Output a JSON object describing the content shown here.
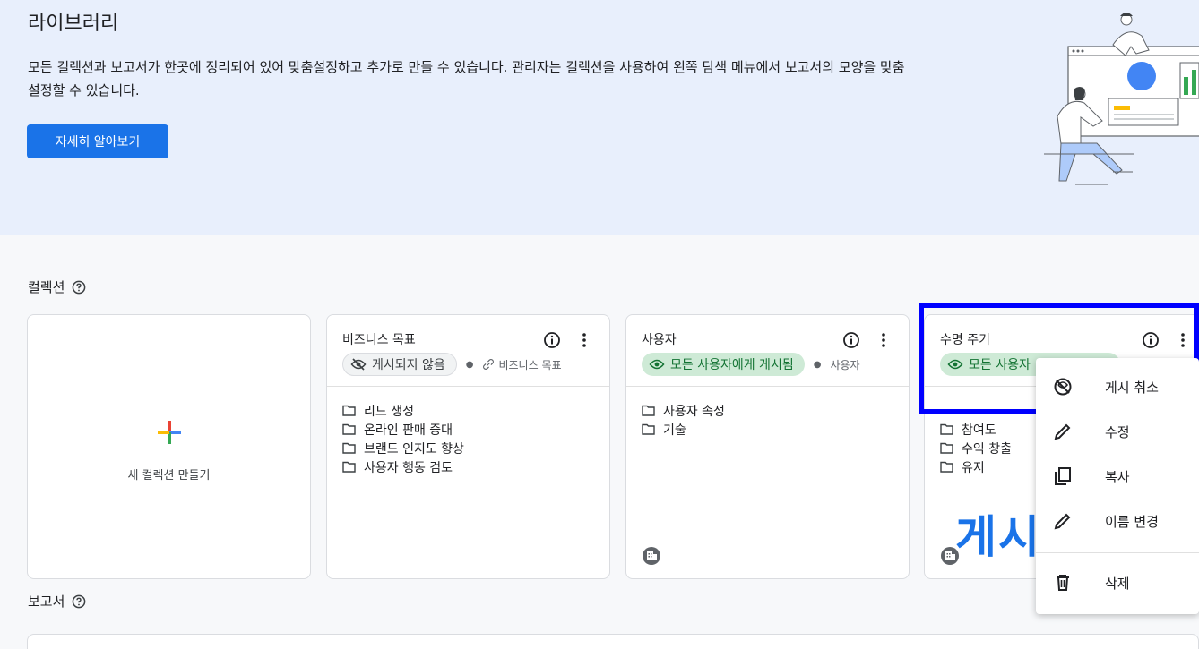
{
  "banner": {
    "title": "라이브러리",
    "description": "모든 컬렉션과 보고서가 한곳에 정리되어 있어 맞춤설정하고 추가로 만들 수 있습니다. 관리자는 컬렉션을 사용하여 왼쪽 탐색 메뉴에서 보고서의 모양을 맞춤설정할 수 있습니다.",
    "learn_more": "자세히 알아보기"
  },
  "collections": {
    "title": "컬렉션",
    "new_label": "새 컬렉션 만들기",
    "cards": [
      {
        "title": "비즈니스 목표",
        "status": "게시되지 않음",
        "status_type": "unpublished",
        "meta": "비즈니스 목표",
        "items": [
          "리드 생성",
          "온라인 판매 증대",
          "브랜드 인지도 향상",
          "사용자 행동 검토"
        ]
      },
      {
        "title": "사용자",
        "status": "모든 사용자에게 게시됨",
        "status_type": "published",
        "meta": "사용자",
        "items": [
          "사용자 속성",
          "기술"
        ]
      },
      {
        "title": "수명 주기",
        "status": "모든 사용자",
        "status_type": "published",
        "items": [
          "참여도",
          "수익 창출",
          "유지"
        ]
      }
    ]
  },
  "context_menu": {
    "items": [
      {
        "label": "게시 취소",
        "icon": "unpublish-icon"
      },
      {
        "label": "수정",
        "icon": "pencil-icon"
      },
      {
        "label": "복사",
        "icon": "copy-icon"
      },
      {
        "label": "이름 변경",
        "icon": "pencil-icon"
      },
      {
        "label": "삭제",
        "icon": "trash-icon"
      }
    ]
  },
  "watermark": "게시",
  "reports": {
    "title": "보고서"
  },
  "colors": {
    "accent": "#1a73e8",
    "banner_bg": "#e8effc",
    "published_chip": "#ceead6",
    "highlight": "#0000ff"
  }
}
